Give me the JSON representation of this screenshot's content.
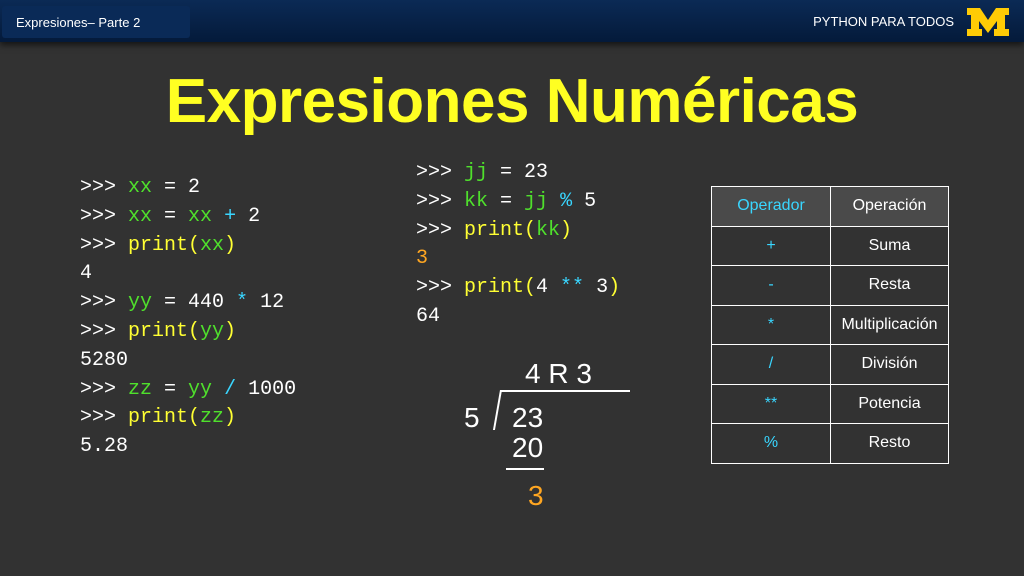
{
  "header": {
    "left_text": "Expresiones– Parte 2",
    "right_text": "PYTHON PARA TODOS",
    "logo_letter": "M"
  },
  "title": "Expresiones Numéricas",
  "code_left": [
    [
      {
        "t": ">>> ",
        "c": ""
      },
      {
        "t": "xx",
        "c": "g"
      },
      {
        "t": " = 2",
        "c": ""
      }
    ],
    [
      {
        "t": ">>> ",
        "c": ""
      },
      {
        "t": "xx",
        "c": "g"
      },
      {
        "t": " = ",
        "c": ""
      },
      {
        "t": "xx",
        "c": "g"
      },
      {
        "t": " ",
        "c": ""
      },
      {
        "t": "+",
        "c": "c"
      },
      {
        "t": " 2",
        "c": ""
      }
    ],
    [
      {
        "t": ">>> ",
        "c": ""
      },
      {
        "t": "print(",
        "c": "y"
      },
      {
        "t": "xx",
        "c": "g"
      },
      {
        "t": ")",
        "c": "y"
      }
    ],
    [
      {
        "t": "4",
        "c": ""
      }
    ],
    [
      {
        "t": ">>> ",
        "c": ""
      },
      {
        "t": "yy",
        "c": "g"
      },
      {
        "t": " = 440 ",
        "c": ""
      },
      {
        "t": "*",
        "c": "c"
      },
      {
        "t": " 12",
        "c": ""
      }
    ],
    [
      {
        "t": ">>> ",
        "c": ""
      },
      {
        "t": "print(",
        "c": "y"
      },
      {
        "t": "yy",
        "c": "g"
      },
      {
        "t": ")",
        "c": "y"
      }
    ],
    [
      {
        "t": "5280",
        "c": ""
      }
    ],
    [
      {
        "t": ">>> ",
        "c": ""
      },
      {
        "t": "zz",
        "c": "g"
      },
      {
        "t": " = ",
        "c": ""
      },
      {
        "t": "yy",
        "c": "g"
      },
      {
        "t": " ",
        "c": ""
      },
      {
        "t": "/",
        "c": "c"
      },
      {
        "t": " 1000",
        "c": ""
      }
    ],
    [
      {
        "t": ">>> ",
        "c": ""
      },
      {
        "t": "print(",
        "c": "y"
      },
      {
        "t": "zz",
        "c": "g"
      },
      {
        "t": ")",
        "c": "y"
      }
    ],
    [
      {
        "t": "5.28",
        "c": ""
      }
    ]
  ],
  "code_right": [
    [
      {
        "t": ">>> ",
        "c": ""
      },
      {
        "t": "jj",
        "c": "g"
      },
      {
        "t": " = 23",
        "c": ""
      }
    ],
    [
      {
        "t": ">>> ",
        "c": ""
      },
      {
        "t": "kk",
        "c": "g"
      },
      {
        "t": " = ",
        "c": ""
      },
      {
        "t": "jj",
        "c": "g"
      },
      {
        "t": " ",
        "c": ""
      },
      {
        "t": "%",
        "c": "c"
      },
      {
        "t": " 5",
        "c": ""
      }
    ],
    [
      {
        "t": ">>> ",
        "c": ""
      },
      {
        "t": "print(",
        "c": "y"
      },
      {
        "t": "kk",
        "c": "g"
      },
      {
        "t": ")",
        "c": "y"
      }
    ],
    [
      {
        "t": "3",
        "c": "o"
      }
    ],
    [
      {
        "t": ">>> ",
        "c": ""
      },
      {
        "t": "print(",
        "c": "y"
      },
      {
        "t": "4 ",
        "c": ""
      },
      {
        "t": "**",
        "c": "c"
      },
      {
        "t": " 3",
        "c": ""
      },
      {
        "t": ")",
        "c": "y"
      }
    ],
    [
      {
        "t": "64",
        "c": ""
      }
    ]
  ],
  "division": {
    "quotient": "4 R 3",
    "divisor": "5",
    "dividend": "23",
    "subtract": "20",
    "remainder": "3"
  },
  "operator_table": {
    "headers": [
      "Operador",
      "Operación"
    ],
    "rows": [
      {
        "symbol": "+",
        "name": "Suma"
      },
      {
        "symbol": "-",
        "name": "Resta"
      },
      {
        "symbol": "*",
        "name": "Multiplicación"
      },
      {
        "symbol": "/",
        "name": "División"
      },
      {
        "symbol": "**",
        "name": "Potencia"
      },
      {
        "symbol": "%",
        "name": "Resto"
      }
    ]
  },
  "colors": {
    "background": "#323232",
    "title": "#ffff22",
    "variable": "#4fe02c",
    "function": "#ffff33",
    "operator": "#39d6ff",
    "result_highlight": "#ffa621",
    "logo": "#ffcb05"
  }
}
